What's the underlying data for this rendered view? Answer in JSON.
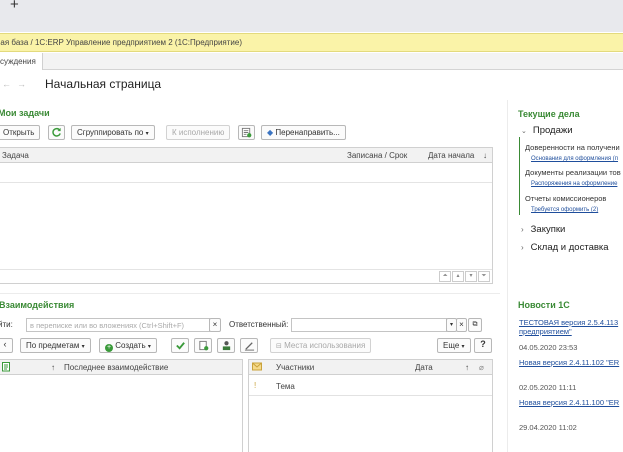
{
  "browser": {
    "new_tab": "+"
  },
  "window": {
    "title": "ная база / 1С:ERP Управление предприятием 2  (1С:Предприятие)"
  },
  "tabs": [
    {
      "label": "суждения"
    }
  ],
  "page": {
    "title": "Начальная страница",
    "back": "←",
    "forward": "→"
  },
  "tasks": {
    "title": "Мои задачи",
    "open_label": "Открыть",
    "group_label": "Сгруппировать по",
    "execute_label": "К исполнению",
    "redirect_label": "Перенаправить...",
    "columns": {
      "task": "Задача",
      "deadline": "Записана / Срок",
      "start": "Дата начала",
      "sort": "↓"
    }
  },
  "current": {
    "title": "Текущие дела",
    "sales": "Продажи",
    "items": [
      {
        "label": "Доверенности на получени",
        "link": "Основания для оформления (п"
      },
      {
        "label": "Документы реализации тов",
        "link": "Распоряжения на оформление"
      },
      {
        "label": "Отчеты комиссионеров",
        "link": "Требуется оформить (2)"
      }
    ],
    "purchases": "Закупки",
    "warehouse": "Склад и доставка"
  },
  "interactions": {
    "title": "Взаимодействия",
    "search_label": "йти:",
    "search_placeholder": "в переписке или во вложениях (Ctrl+Shift+F)",
    "clear": "×",
    "responsible_label": "Ответственный:",
    "by_subject": "По предметам",
    "create": "Создать",
    "usage_places": "Места использования",
    "more": "Еще",
    "help": "?",
    "left_columns": {
      "sort": "↑",
      "last": "Последнее взаимодействие"
    },
    "right_columns": {
      "participants": "Участники",
      "date": "Дата",
      "sort": "↑",
      "topic": "Тема"
    }
  },
  "news": {
    "title": "Новости 1С",
    "items": [
      {
        "link": "ТЕСТОВАЯ версия 2.5.4.113",
        "link2": "предприятием\"",
        "date": "04.05.2020 23:53"
      },
      {
        "link": "Новая версия 2.4.11.102 \"ER",
        "date": "02.05.2020 11:11"
      },
      {
        "link": "Новая версия 2.4.11.100 \"ER",
        "date": "29.04.2020 11:02"
      }
    ]
  },
  "colors": {
    "accent_green": "#3a8a35",
    "link_blue": "#1f4e9c",
    "title_bar": "#faf3a8"
  },
  "icons": [
    "refresh-icon",
    "create-icon",
    "check-icon",
    "copy-icon",
    "user-icon",
    "pen-icon",
    "list-icon",
    "attach-icon"
  ]
}
